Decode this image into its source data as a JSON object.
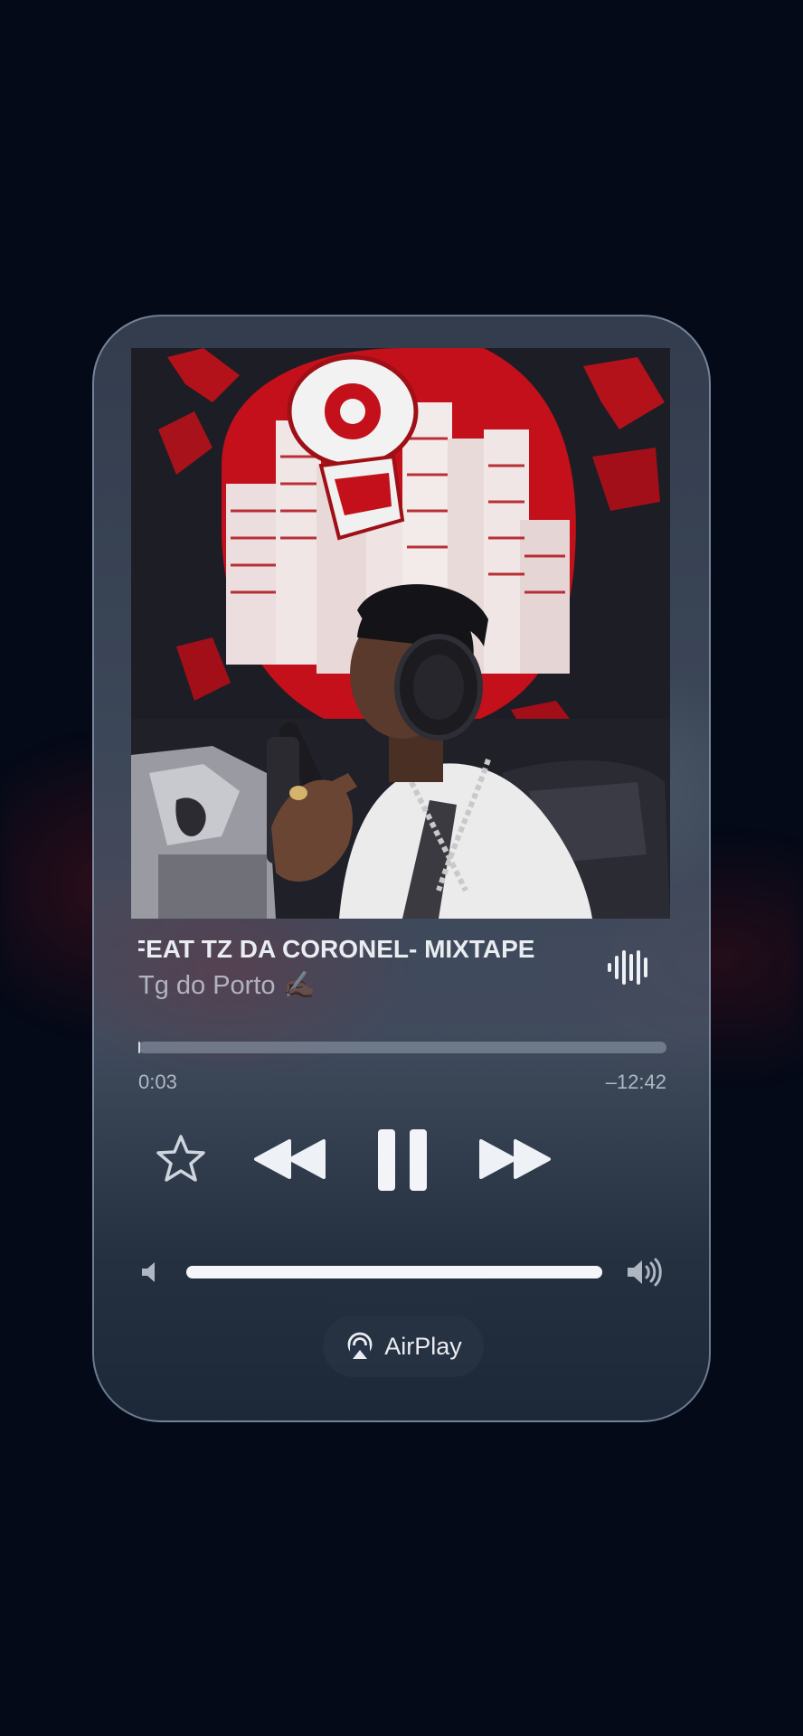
{
  "now_playing": {
    "title": "FEAT TZ DA CORONEL- MIXTAPE",
    "artist": "Tg do Porto ✍🏿",
    "artwork_icon": "album-artwork",
    "wave_icon": "waveform-icon"
  },
  "progress": {
    "elapsed": "0:03",
    "remaining": "–12:42",
    "fraction": 0.004
  },
  "controls": {
    "favorite_icon": "star-icon",
    "rewind_icon": "rewind-icon",
    "pause_icon": "pause-icon",
    "forward_icon": "fast-forward-icon"
  },
  "volume": {
    "level": 1.0,
    "low_icon": "speaker-low-icon",
    "high_icon": "speaker-high-icon"
  },
  "airplay": {
    "label": "AirPlay",
    "icon": "airplay-icon"
  },
  "colors": {
    "background": "#050a18",
    "text_primary": "#e9ecf1",
    "accent_red": "#c3101a"
  }
}
